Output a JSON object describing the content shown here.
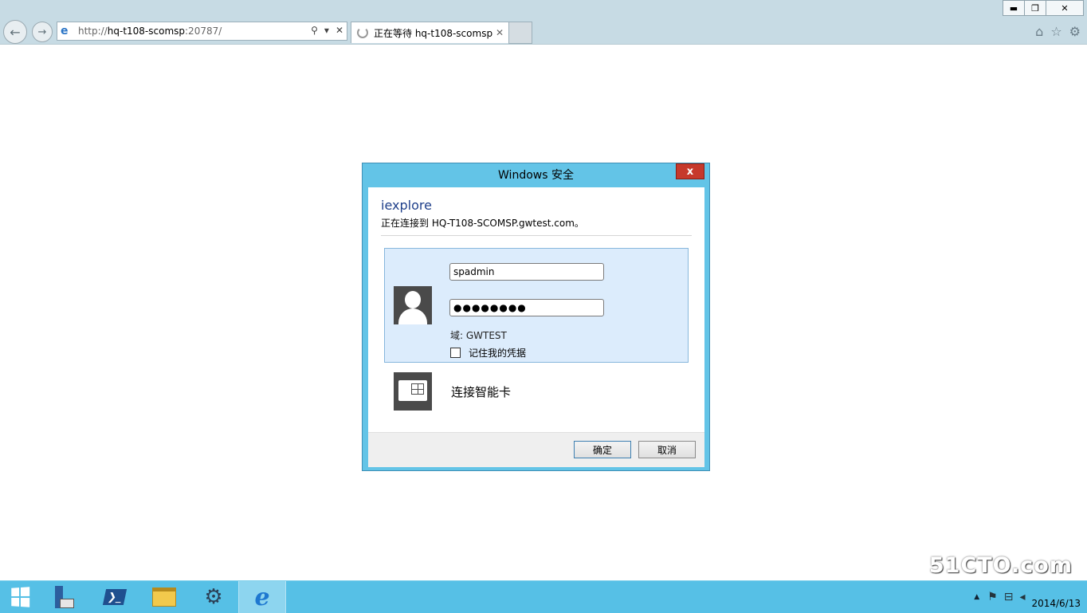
{
  "browser": {
    "address": {
      "prefix": "http://",
      "host": "hq-t108-scomsp",
      "port": ":20787/"
    },
    "tab_title": "正在等待 hq-t108-scomsp",
    "window_controls": {
      "minimize": "▬",
      "restore": "❐",
      "close": "✕"
    }
  },
  "dialog": {
    "title": "Windows 安全",
    "close_glyph": "x",
    "app": "iexplore",
    "connecting": "正在连接到 HQ-T108-SCOMSP.gwtest.com。",
    "username": "spadmin",
    "password_mask": "●●●●●●●●",
    "domain": "域: GWTEST",
    "remember": "记住我的凭据",
    "smartcard": "连接智能卡",
    "ok": "确定",
    "cancel": "取消"
  },
  "taskbar": {
    "date": "2014/6/13",
    "watermark": "51CTO.com"
  },
  "colors": {
    "dialog_frame": "#63c4e7",
    "credential_bg": "#dcecfc",
    "taskbar": "#56c0e6",
    "close_red": "#c6392c"
  }
}
